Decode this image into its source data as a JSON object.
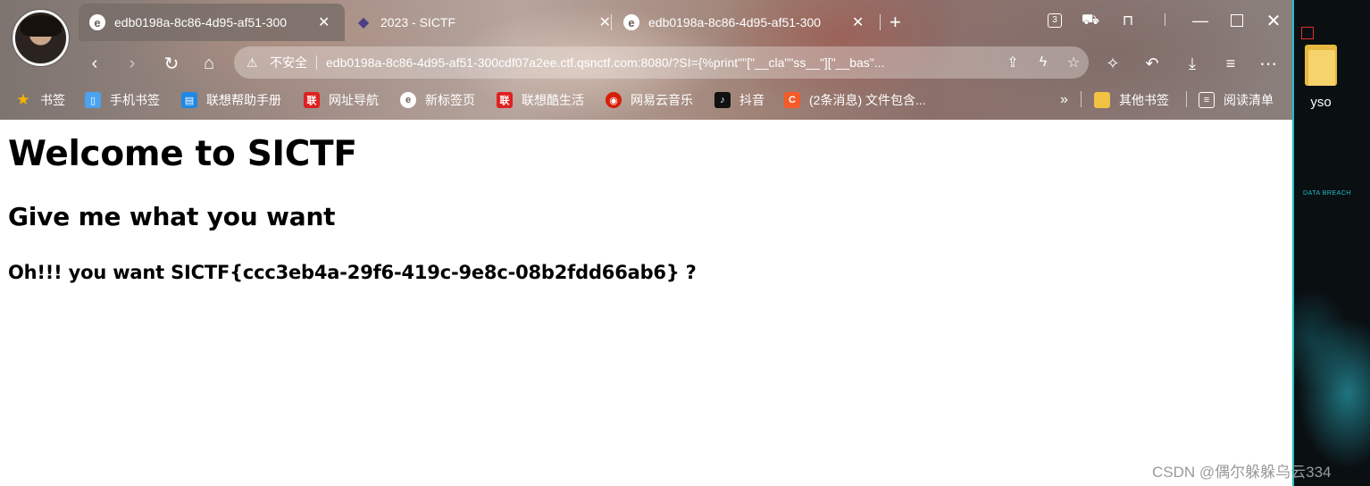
{
  "tabs": [
    {
      "title": "edb0198a-8c86-4d95-af51-300",
      "favicon": "edge-icon",
      "active": true
    },
    {
      "title": "2023 - SICTF",
      "favicon": "sictf-icon",
      "active": false
    },
    {
      "title": "edb0198a-8c86-4d95-af51-300",
      "favicon": "edge-icon",
      "active": false
    }
  ],
  "window": {
    "tab_count": "3"
  },
  "address": {
    "security_label": "不安全",
    "url": "edb0198a-8c86-4d95-af51-300cdf07a2ee.ctf.qsnctf.com:8080/?SI={%print\"\"[\"__cla\"\"ss__\"][\"__bas\"..."
  },
  "bookmarks": [
    {
      "label": "书签",
      "icon": "star-icon",
      "color": "#f5b400"
    },
    {
      "label": "手机书签",
      "icon": "phone-icon",
      "color": "#4aa3f0"
    },
    {
      "label": "联想帮助手册",
      "icon": "book-icon",
      "color": "#1e88e5"
    },
    {
      "label": "网址导航",
      "icon": "lenovo-icon",
      "color": "#e02020"
    },
    {
      "label": "新标签页",
      "icon": "edge-icon",
      "color": "#ffffff"
    },
    {
      "label": "联想酷生活",
      "icon": "lenovo-icon",
      "color": "#e02020"
    },
    {
      "label": "网易云音乐",
      "icon": "netease-music-icon",
      "color": "#d81e06"
    },
    {
      "label": "抖音",
      "icon": "douyin-icon",
      "color": "#111111"
    },
    {
      "label": "(2条消息) 文件包含...",
      "icon": "csdn-icon",
      "color": "#f55a28"
    }
  ],
  "bookmarks_overflow": "»",
  "other_bookmarks": "其他书签",
  "reading_list": "阅读清单",
  "page": {
    "h1": "Welcome to SICTF",
    "h2": "Give me what you want",
    "h3": "Oh!!! you want SICTF{ccc3eb4a-29f6-419c-9e8c-08b2fdd66ab6} ?"
  },
  "desktop": {
    "folder_label": "yso",
    "wallpaper_text": "DATA BREACH"
  },
  "watermark": "CSDN @偶尔躲躲乌云334"
}
